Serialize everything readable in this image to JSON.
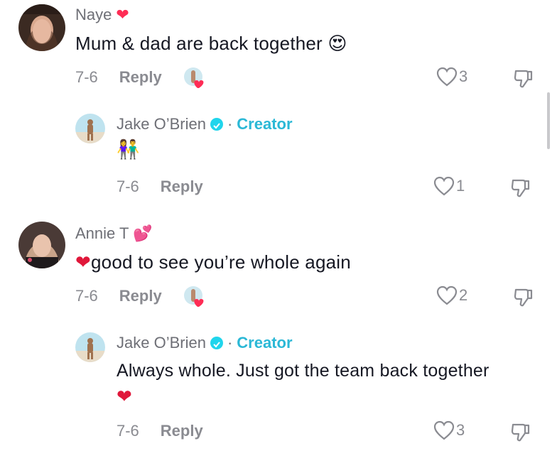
{
  "comments": [
    {
      "author": "Naye",
      "author_badge": "❤",
      "text": "Mum & dad are back together",
      "text_emoji": "😍",
      "date": "7-6",
      "reply_label": "Reply",
      "likes": "3",
      "creator_liked": true,
      "reply": {
        "author": "Jake O’Brien",
        "separator": "·",
        "creator_label": "Creator",
        "text": "👫",
        "date": "7-6",
        "reply_label": "Reply",
        "likes": "1"
      }
    },
    {
      "author": "Annie T",
      "author_badge": "💕",
      "text_emoji": "❤",
      "text": "good to see you’re whole again",
      "date": "7-6",
      "reply_label": "Reply",
      "likes": "2",
      "creator_liked": true,
      "reply": {
        "author": "Jake O’Brien",
        "separator": "·",
        "creator_label": "Creator",
        "text": "Always whole. Just got the team back together",
        "text_emoji": "❤",
        "date": "7-6",
        "reply_label": "Reply",
        "likes": "3"
      }
    }
  ],
  "colors": {
    "accent_creator": "#2bb8d6",
    "muted": "#8a8b91",
    "text": "#161823",
    "heart": "#fe2c55"
  }
}
